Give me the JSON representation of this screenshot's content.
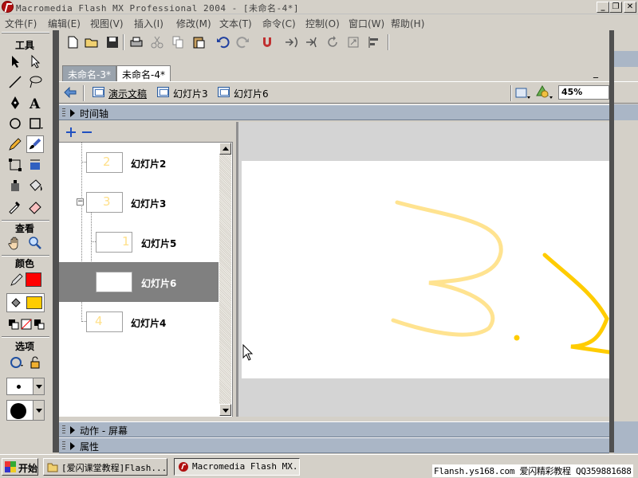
{
  "window": {
    "title": "Macromedia Flash MX Professional 2004 - [未命名-4*]",
    "min_glyph": "_",
    "restore_glyph": "❐",
    "close_glyph": "✕"
  },
  "menu": [
    "文件(F)",
    "编辑(E)",
    "视图(V)",
    "插入(I)",
    "修改(M)",
    "文本(T)",
    "命令(C)",
    "控制(O)",
    "窗口(W)",
    "帮助(H)"
  ],
  "tools_panel": {
    "title": "工具",
    "view_header": "查看",
    "colors_header": "颜色",
    "options_header": "选项",
    "stroke_color": "#ff0000",
    "fill_color": "#ffcc00"
  },
  "doc_tabs": [
    {
      "label": "未命名-3*"
    },
    {
      "label": "未命名-4*"
    }
  ],
  "breadcrumb": {
    "items": [
      "演示文稿",
      "幻灯片3",
      "幻灯片6"
    ],
    "zoom": "45%"
  },
  "timeline_panel": {
    "label": "时间轴"
  },
  "slides": [
    {
      "label": "幻灯片2",
      "thumb": "2"
    },
    {
      "label": "幻灯片3",
      "thumb": "3"
    },
    {
      "label": "幻灯片5",
      "thumb": "1"
    },
    {
      "label": "幻灯片6",
      "thumb": ""
    },
    {
      "label": "幻灯片4",
      "thumb": "4"
    }
  ],
  "bottom_panels": {
    "actions": "动作 - 屏幕",
    "properties": "属性"
  },
  "taskbar": {
    "start": "开始",
    "tasks": [
      "[爱闪课堂教程]Flash...",
      "Macromedia Flash MX..."
    ],
    "watermark": "Flansh.ys168.com 爱闪精彩教程 QQ359881688"
  },
  "colors": {
    "accent_stroke": "#ffe080",
    "accent_dark": "#ffcc00"
  }
}
